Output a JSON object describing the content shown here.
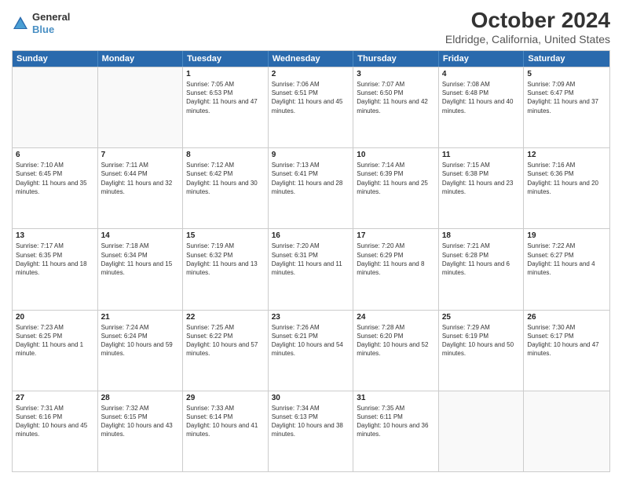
{
  "header": {
    "logo": {
      "line1": "General",
      "line2": "Blue"
    },
    "title": "October 2024",
    "subtitle": "Eldridge, California, United States"
  },
  "calendar": {
    "days_of_week": [
      "Sunday",
      "Monday",
      "Tuesday",
      "Wednesday",
      "Thursday",
      "Friday",
      "Saturday"
    ],
    "rows": [
      [
        {
          "day": "",
          "sunrise": "",
          "sunset": "",
          "daylight": ""
        },
        {
          "day": "",
          "sunrise": "",
          "sunset": "",
          "daylight": ""
        },
        {
          "day": "1",
          "sunrise": "Sunrise: 7:05 AM",
          "sunset": "Sunset: 6:53 PM",
          "daylight": "Daylight: 11 hours and 47 minutes."
        },
        {
          "day": "2",
          "sunrise": "Sunrise: 7:06 AM",
          "sunset": "Sunset: 6:51 PM",
          "daylight": "Daylight: 11 hours and 45 minutes."
        },
        {
          "day": "3",
          "sunrise": "Sunrise: 7:07 AM",
          "sunset": "Sunset: 6:50 PM",
          "daylight": "Daylight: 11 hours and 42 minutes."
        },
        {
          "day": "4",
          "sunrise": "Sunrise: 7:08 AM",
          "sunset": "Sunset: 6:48 PM",
          "daylight": "Daylight: 11 hours and 40 minutes."
        },
        {
          "day": "5",
          "sunrise": "Sunrise: 7:09 AM",
          "sunset": "Sunset: 6:47 PM",
          "daylight": "Daylight: 11 hours and 37 minutes."
        }
      ],
      [
        {
          "day": "6",
          "sunrise": "Sunrise: 7:10 AM",
          "sunset": "Sunset: 6:45 PM",
          "daylight": "Daylight: 11 hours and 35 minutes."
        },
        {
          "day": "7",
          "sunrise": "Sunrise: 7:11 AM",
          "sunset": "Sunset: 6:44 PM",
          "daylight": "Daylight: 11 hours and 32 minutes."
        },
        {
          "day": "8",
          "sunrise": "Sunrise: 7:12 AM",
          "sunset": "Sunset: 6:42 PM",
          "daylight": "Daylight: 11 hours and 30 minutes."
        },
        {
          "day": "9",
          "sunrise": "Sunrise: 7:13 AM",
          "sunset": "Sunset: 6:41 PM",
          "daylight": "Daylight: 11 hours and 28 minutes."
        },
        {
          "day": "10",
          "sunrise": "Sunrise: 7:14 AM",
          "sunset": "Sunset: 6:39 PM",
          "daylight": "Daylight: 11 hours and 25 minutes."
        },
        {
          "day": "11",
          "sunrise": "Sunrise: 7:15 AM",
          "sunset": "Sunset: 6:38 PM",
          "daylight": "Daylight: 11 hours and 23 minutes."
        },
        {
          "day": "12",
          "sunrise": "Sunrise: 7:16 AM",
          "sunset": "Sunset: 6:36 PM",
          "daylight": "Daylight: 11 hours and 20 minutes."
        }
      ],
      [
        {
          "day": "13",
          "sunrise": "Sunrise: 7:17 AM",
          "sunset": "Sunset: 6:35 PM",
          "daylight": "Daylight: 11 hours and 18 minutes."
        },
        {
          "day": "14",
          "sunrise": "Sunrise: 7:18 AM",
          "sunset": "Sunset: 6:34 PM",
          "daylight": "Daylight: 11 hours and 15 minutes."
        },
        {
          "day": "15",
          "sunrise": "Sunrise: 7:19 AM",
          "sunset": "Sunset: 6:32 PM",
          "daylight": "Daylight: 11 hours and 13 minutes."
        },
        {
          "day": "16",
          "sunrise": "Sunrise: 7:20 AM",
          "sunset": "Sunset: 6:31 PM",
          "daylight": "Daylight: 11 hours and 11 minutes."
        },
        {
          "day": "17",
          "sunrise": "Sunrise: 7:20 AM",
          "sunset": "Sunset: 6:29 PM",
          "daylight": "Daylight: 11 hours and 8 minutes."
        },
        {
          "day": "18",
          "sunrise": "Sunrise: 7:21 AM",
          "sunset": "Sunset: 6:28 PM",
          "daylight": "Daylight: 11 hours and 6 minutes."
        },
        {
          "day": "19",
          "sunrise": "Sunrise: 7:22 AM",
          "sunset": "Sunset: 6:27 PM",
          "daylight": "Daylight: 11 hours and 4 minutes."
        }
      ],
      [
        {
          "day": "20",
          "sunrise": "Sunrise: 7:23 AM",
          "sunset": "Sunset: 6:25 PM",
          "daylight": "Daylight: 11 hours and 1 minute."
        },
        {
          "day": "21",
          "sunrise": "Sunrise: 7:24 AM",
          "sunset": "Sunset: 6:24 PM",
          "daylight": "Daylight: 10 hours and 59 minutes."
        },
        {
          "day": "22",
          "sunrise": "Sunrise: 7:25 AM",
          "sunset": "Sunset: 6:22 PM",
          "daylight": "Daylight: 10 hours and 57 minutes."
        },
        {
          "day": "23",
          "sunrise": "Sunrise: 7:26 AM",
          "sunset": "Sunset: 6:21 PM",
          "daylight": "Daylight: 10 hours and 54 minutes."
        },
        {
          "day": "24",
          "sunrise": "Sunrise: 7:28 AM",
          "sunset": "Sunset: 6:20 PM",
          "daylight": "Daylight: 10 hours and 52 minutes."
        },
        {
          "day": "25",
          "sunrise": "Sunrise: 7:29 AM",
          "sunset": "Sunset: 6:19 PM",
          "daylight": "Daylight: 10 hours and 50 minutes."
        },
        {
          "day": "26",
          "sunrise": "Sunrise: 7:30 AM",
          "sunset": "Sunset: 6:17 PM",
          "daylight": "Daylight: 10 hours and 47 minutes."
        }
      ],
      [
        {
          "day": "27",
          "sunrise": "Sunrise: 7:31 AM",
          "sunset": "Sunset: 6:16 PM",
          "daylight": "Daylight: 10 hours and 45 minutes."
        },
        {
          "day": "28",
          "sunrise": "Sunrise: 7:32 AM",
          "sunset": "Sunset: 6:15 PM",
          "daylight": "Daylight: 10 hours and 43 minutes."
        },
        {
          "day": "29",
          "sunrise": "Sunrise: 7:33 AM",
          "sunset": "Sunset: 6:14 PM",
          "daylight": "Daylight: 10 hours and 41 minutes."
        },
        {
          "day": "30",
          "sunrise": "Sunrise: 7:34 AM",
          "sunset": "Sunset: 6:13 PM",
          "daylight": "Daylight: 10 hours and 38 minutes."
        },
        {
          "day": "31",
          "sunrise": "Sunrise: 7:35 AM",
          "sunset": "Sunset: 6:11 PM",
          "daylight": "Daylight: 10 hours and 36 minutes."
        },
        {
          "day": "",
          "sunrise": "",
          "sunset": "",
          "daylight": ""
        },
        {
          "day": "",
          "sunrise": "",
          "sunset": "",
          "daylight": ""
        }
      ]
    ]
  }
}
